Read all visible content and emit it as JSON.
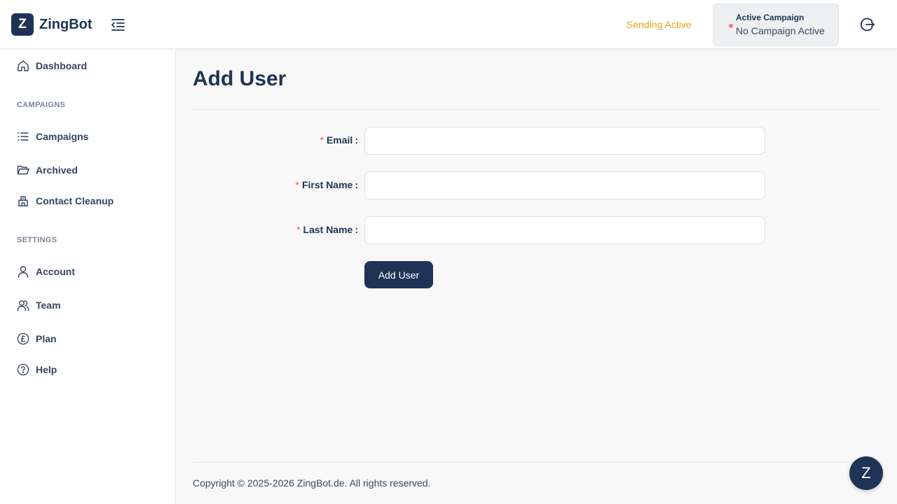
{
  "header": {
    "logo_letter": "Z",
    "app_name": "ZingBot",
    "sending_status": "Sending Active",
    "campaign": {
      "title": "Active Campaign",
      "value": "No Campaign Active"
    }
  },
  "sidebar": {
    "dashboard": "Dashboard",
    "campaigns_section": "CAMPAIGNS",
    "campaigns": "Campaigns",
    "archived": "Archived",
    "contact_cleanup": "Contact Cleanup",
    "settings_section": "SETTINGS",
    "account": "Account",
    "team": "Team",
    "plan": "Plan",
    "help": "Help"
  },
  "main": {
    "title": "Add User",
    "form": {
      "required_mark": "*",
      "colon": ":",
      "email_label": "Email",
      "email_value": "",
      "first_name_label": "First Name",
      "first_name_value": "",
      "last_name_label": "Last Name",
      "last_name_value": "",
      "submit_label": "Add User"
    }
  },
  "footer": {
    "copyright": "Copyright © 2025-2026 ZingBot.de. All rights reserved."
  },
  "chat": {
    "letter": "Z"
  },
  "colors": {
    "primary": "#1f3356",
    "sending_status": "#e8a317",
    "inactive_dot": "#f07a7a",
    "required": "#f05656"
  },
  "icons": [
    "menu-collapse-icon",
    "logout-icon",
    "home-icon",
    "list-icon",
    "folder-open-icon",
    "building-icon",
    "user-icon",
    "users-icon",
    "pound-icon",
    "help-circle-icon"
  ]
}
